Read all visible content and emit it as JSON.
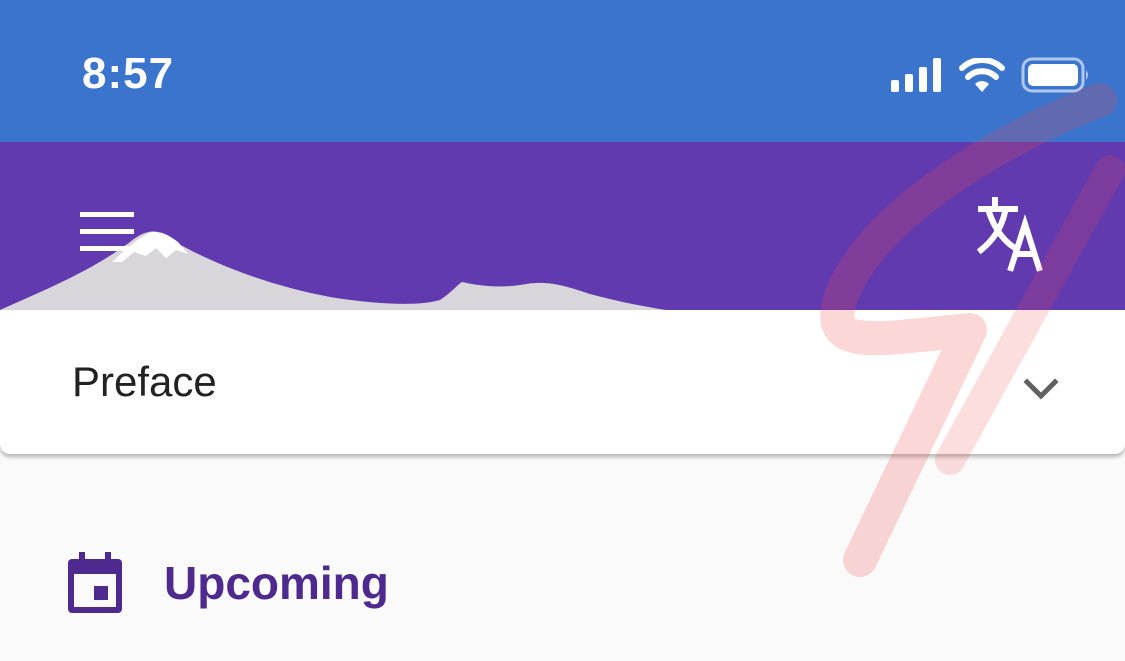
{
  "status_bar": {
    "time": "8:57",
    "icons": [
      "cellular-signal-icon",
      "wifi-icon",
      "battery-icon"
    ]
  },
  "header": {
    "menu_icon": "hamburger-menu-icon",
    "translate_icon": "translate-icon",
    "background_color": "#623ab0"
  },
  "chapter_selector": {
    "label": "Preface",
    "icon": "chevron-down-icon"
  },
  "upcoming": {
    "label": "Upcoming",
    "icon": "calendar-icon",
    "color": "#4e2a8e"
  },
  "colors": {
    "status_bar": "#3a74cd",
    "header": "#623ab0",
    "accent": "#4e2a8e",
    "page_background": "#fafafa"
  }
}
